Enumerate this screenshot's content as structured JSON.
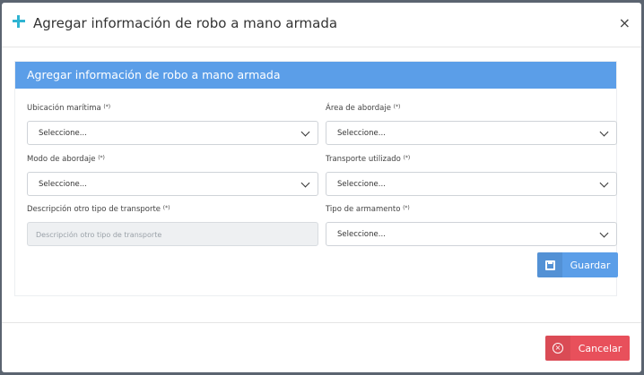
{
  "modal": {
    "title": "Agregar información de robo a mano armada",
    "close_symbol": "×"
  },
  "panel": {
    "heading": "Agregar información de robo a mano armada"
  },
  "fields": {
    "ubicacion": {
      "label": "Ubicación marítima",
      "req": "(*)",
      "value": "Seleccione..."
    },
    "area": {
      "label": "Área de abordaje",
      "req": "(*)",
      "value": "Seleccione..."
    },
    "modo": {
      "label": "Modo de abordaje",
      "req": "(*)",
      "value": "Seleccione..."
    },
    "transporte": {
      "label": "Transporte utilizado",
      "req": "(*)",
      "value": "Seleccione..."
    },
    "descripcion": {
      "label": "Descripción otro tipo de transporte",
      "req": "(*)",
      "placeholder": "Descripción otro tipo de transporte"
    },
    "armamento": {
      "label": "Tipo de armamento",
      "req": "(*)",
      "value": "Seleccione..."
    }
  },
  "buttons": {
    "guardar": "Guardar",
    "cancelar": "Cancelar"
  },
  "icons": {
    "header": "plus-icon",
    "close": "close-icon",
    "save": "save-icon",
    "cancel": "cancel-icon"
  },
  "colors": {
    "primary": "#5b9ee8",
    "danger": "#e8505b",
    "accent_plus": "#2fb4d2"
  }
}
